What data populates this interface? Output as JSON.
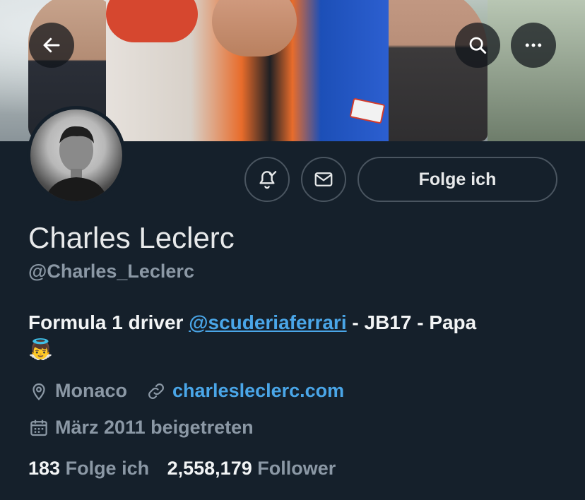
{
  "profile": {
    "name": "Charles Leclerc",
    "handle": "@Charles_Leclerc",
    "bio_prefix": "Formula 1 driver ",
    "bio_mention": "@scuderiaferrari",
    "bio_suffix": " - JB17 - Papa",
    "bio_emoji": "👼",
    "location": "Monaco",
    "website": "charlesleclerc.com",
    "joined": "März 2011 beigetreten",
    "following_count": "183",
    "following_label": "Folge ich",
    "followers_count": "2,558,179",
    "followers_label": "Follower"
  },
  "actions": {
    "follow_label": "Folge ich"
  },
  "icons": {
    "back": "arrow-left-icon",
    "search": "search-icon",
    "more": "more-icon",
    "notify": "bell-check-icon",
    "message": "envelope-icon",
    "location": "location-pin-icon",
    "link": "link-icon",
    "calendar": "calendar-icon"
  },
  "colors": {
    "background": "#15202b",
    "link": "#4aa6e8",
    "muted": "#8b98a5",
    "text": "#e7e9ea"
  }
}
